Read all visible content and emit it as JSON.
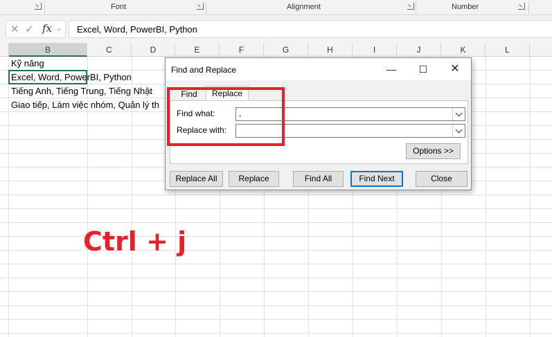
{
  "ribbon": {
    "groups": [
      "Font",
      "Alignment",
      "Number"
    ]
  },
  "formula_bar": {
    "cancel_icon": "close-icon",
    "enter_icon": "check-icon",
    "fx_label": "fx",
    "value": "Excel, Word, PowerBI, Python"
  },
  "columns": [
    "B",
    "C",
    "D",
    "E",
    "F",
    "G",
    "H",
    "I",
    "J",
    "K",
    "L"
  ],
  "cells": {
    "b1": "Kỹ năng",
    "b2": "Excel, Word, PowerBI, Python",
    "b3": "Tiếng Anh, Tiếng Trung, Tiếng Nhật",
    "b4": "Giao tiếp, Làm việc nhóm, Quản lý th"
  },
  "dialog": {
    "title": "Find and Replace",
    "tabs": [
      "Find",
      "Replace"
    ],
    "find_what_label": "Find what:",
    "find_what_value": ",",
    "replace_with_label": "Replace with:",
    "replace_with_value": "",
    "options_label": "Options >>",
    "buttons": {
      "replace_all": "Replace All",
      "replace": "Replace",
      "find_all": "Find All",
      "find_next": "Find Next",
      "close": "Close"
    }
  },
  "caption": "Ctrl + j",
  "colors": {
    "highlight": "#e8202a",
    "excel_green": "#217346",
    "default_button_border": "#0078d7"
  }
}
